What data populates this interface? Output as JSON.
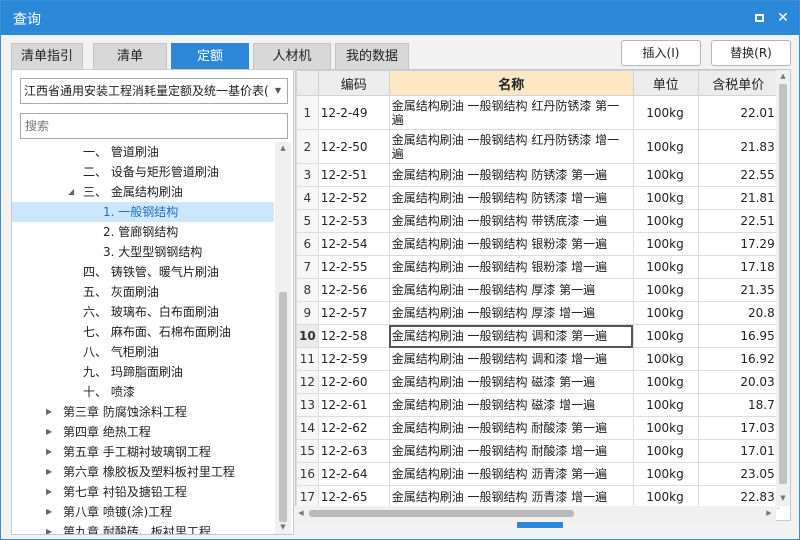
{
  "window": {
    "title": "查询"
  },
  "tabs": [
    {
      "label": "清单指引",
      "active": false
    },
    {
      "label": "清单",
      "active": false
    },
    {
      "label": "定额",
      "active": true
    },
    {
      "label": "人材机",
      "active": false
    },
    {
      "label": "我的数据",
      "active": false
    }
  ],
  "actions": {
    "insert_label": "插入(I)",
    "replace_label": "替换(R)"
  },
  "library": {
    "selected": "江西省通用安装工程消耗量定额及统一基价表("
  },
  "search": {
    "placeholder": "搜索",
    "value": ""
  },
  "tree": [
    {
      "label": "一、 管道刷油",
      "expandable": false
    },
    {
      "label": "二、 设备与矩形管道刷油",
      "expandable": false
    },
    {
      "label": "三、 金属结构刷油",
      "expandable": true,
      "expanded": true
    },
    {
      "label": "1. 一般钢结构",
      "selected": true
    },
    {
      "label": "2. 管廊钢结构"
    },
    {
      "label": "3. 大型型钢钢结构"
    },
    {
      "label": "四、 铸铁管、暖气片刷油"
    },
    {
      "label": "五、 灰面刷油"
    },
    {
      "label": "六、 玻璃布、白布面刷油"
    },
    {
      "label": "七、 麻布面、石棉布面刷油"
    },
    {
      "label": "八、 气柜刷油"
    },
    {
      "label": "九、 玛蹄脂面刷油"
    },
    {
      "label": "十、 喷漆"
    },
    {
      "label": "第三章 防腐蚀涂料工程",
      "expandable": true
    },
    {
      "label": "第四章 绝热工程",
      "expandable": true
    },
    {
      "label": "第五章 手工糊衬玻璃钢工程",
      "expandable": true
    },
    {
      "label": "第六章 橡胶板及塑料板衬里工程",
      "expandable": true
    },
    {
      "label": "第七章 衬铅及搪铅工程",
      "expandable": true
    },
    {
      "label": "第八章 喷镀(涂)工程",
      "expandable": true
    },
    {
      "label": "第九章 耐酸砖、板衬里工程",
      "expandable": true
    }
  ],
  "table": {
    "columns": [
      "",
      "编码",
      "名称",
      "单位",
      "含税单价"
    ],
    "current_row": 10,
    "rows": [
      {
        "n": "1",
        "code": "12-2-49",
        "name": "金属结构刷油 一般钢结构 红丹防锈漆 第一遍",
        "unit": "100kg",
        "price": "22.01"
      },
      {
        "n": "2",
        "code": "12-2-50",
        "name": "金属结构刷油 一般钢结构 红丹防锈漆 增一遍",
        "unit": "100kg",
        "price": "21.83"
      },
      {
        "n": "3",
        "code": "12-2-51",
        "name": "金属结构刷油 一般钢结构 防锈漆 第一遍",
        "unit": "100kg",
        "price": "22.55"
      },
      {
        "n": "4",
        "code": "12-2-52",
        "name": "金属结构刷油 一般钢结构 防锈漆 增一遍",
        "unit": "100kg",
        "price": "21.81"
      },
      {
        "n": "5",
        "code": "12-2-53",
        "name": "金属结构刷油 一般钢结构 带锈底漆 一遍",
        "unit": "100kg",
        "price": "22.51"
      },
      {
        "n": "6",
        "code": "12-2-54",
        "name": "金属结构刷油 一般钢结构 银粉漆 第一遍",
        "unit": "100kg",
        "price": "17.29"
      },
      {
        "n": "7",
        "code": "12-2-55",
        "name": "金属结构刷油 一般钢结构 银粉漆 增一遍",
        "unit": "100kg",
        "price": "17.18"
      },
      {
        "n": "8",
        "code": "12-2-56",
        "name": "金属结构刷油 一般钢结构 厚漆 第一遍",
        "unit": "100kg",
        "price": "21.35"
      },
      {
        "n": "9",
        "code": "12-2-57",
        "name": "金属结构刷油 一般钢结构 厚漆 增一遍",
        "unit": "100kg",
        "price": "20.8"
      },
      {
        "n": "10",
        "code": "12-2-58",
        "name": "金属结构刷油 一般钢结构 调和漆 第一遍",
        "unit": "100kg",
        "price": "16.95"
      },
      {
        "n": "11",
        "code": "12-2-59",
        "name": "金属结构刷油 一般钢结构 调和漆 增一遍",
        "unit": "100kg",
        "price": "16.92"
      },
      {
        "n": "12",
        "code": "12-2-60",
        "name": "金属结构刷油 一般钢结构 磁漆 第一遍",
        "unit": "100kg",
        "price": "20.03"
      },
      {
        "n": "13",
        "code": "12-2-61",
        "name": "金属结构刷油 一般钢结构 磁漆 增一遍",
        "unit": "100kg",
        "price": "18.7"
      },
      {
        "n": "14",
        "code": "12-2-62",
        "name": "金属结构刷油 一般钢结构 耐酸漆 第一遍",
        "unit": "100kg",
        "price": "17.03"
      },
      {
        "n": "15",
        "code": "12-2-63",
        "name": "金属结构刷油 一般钢结构 耐酸漆 增一遍",
        "unit": "100kg",
        "price": "17.01"
      },
      {
        "n": "16",
        "code": "12-2-64",
        "name": "金属结构刷油 一般钢结构 沥青漆 第一遍",
        "unit": "100kg",
        "price": "23.05"
      },
      {
        "n": "17",
        "code": "12-2-65",
        "name": "金属结构刷油 一般钢结构 沥青漆 增一遍",
        "unit": "100kg",
        "price": "22.83"
      }
    ]
  },
  "icons": {
    "maximize": "maximize-icon",
    "close": "close-icon",
    "dropdown": "chevron-down-icon",
    "expand": "caret-right-icon",
    "collapse": "caret-down-icon"
  },
  "colors": {
    "accent": "#2b88d9",
    "selected_bg": "#cde6fb",
    "header_highlight": "#fbe7c4"
  }
}
